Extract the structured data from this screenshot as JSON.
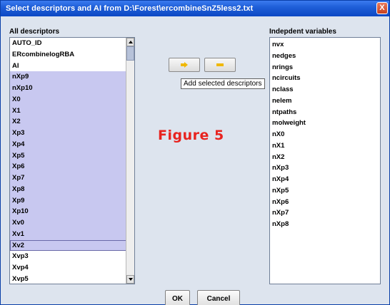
{
  "window": {
    "title": "Select descriptors and AI from D:\\Forest\\ercombineSnZ5less2.txt",
    "close_glyph": "X"
  },
  "left_panel": {
    "title": "All descriptors",
    "items": [
      {
        "label": "AUTO_ID",
        "selected": false
      },
      {
        "label": "ERcombinelogRBA",
        "selected": false
      },
      {
        "label": "AI",
        "selected": false
      },
      {
        "label": "nXp9",
        "selected": true
      },
      {
        "label": "nXp10",
        "selected": true
      },
      {
        "label": "X0",
        "selected": true
      },
      {
        "label": "X1",
        "selected": true
      },
      {
        "label": "X2",
        "selected": true
      },
      {
        "label": "Xp3",
        "selected": true
      },
      {
        "label": "Xp4",
        "selected": true
      },
      {
        "label": "Xp5",
        "selected": true
      },
      {
        "label": "Xp6",
        "selected": true
      },
      {
        "label": "Xp7",
        "selected": true
      },
      {
        "label": "Xp8",
        "selected": true
      },
      {
        "label": "Xp9",
        "selected": true
      },
      {
        "label": "Xp10",
        "selected": true
      },
      {
        "label": "Xv0",
        "selected": true
      },
      {
        "label": "Xv1",
        "selected": true
      },
      {
        "label": "Xv2",
        "selected": true
      },
      {
        "label": "Xvp3",
        "selected": false
      },
      {
        "label": "Xvp4",
        "selected": false
      },
      {
        "label": "Xvp5",
        "selected": false
      }
    ]
  },
  "right_panel": {
    "title": "Indepdent variables",
    "items": [
      "nvx",
      "nedges",
      "nrings",
      "ncircuits",
      "nclass",
      "nelem",
      "ntpaths",
      "molweight",
      "nX0",
      "nX1",
      "nX2",
      "nXp3",
      "nXp4",
      "nXp5",
      "nXp6",
      "nXp7",
      "nXp8"
    ]
  },
  "toolbar": {
    "add_icon": "right-arrow-icon",
    "remove_icon": "minus-icon",
    "tooltip": "Add selected descriptors",
    "accent_color": "#f0b800"
  },
  "annotation": {
    "label": "Figure 5",
    "color": "#e8231f"
  },
  "buttons": {
    "ok": "OK",
    "cancel": "Cancel"
  }
}
